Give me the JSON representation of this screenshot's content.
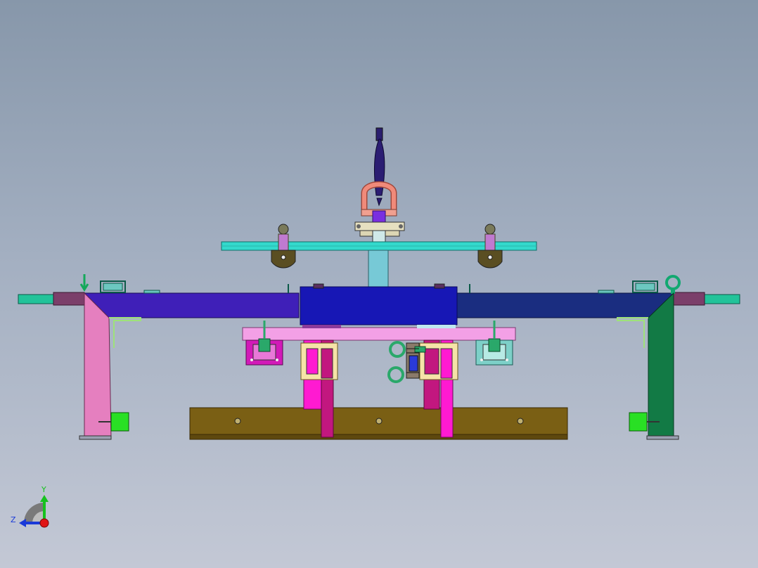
{
  "viewport": {
    "background_top": "#8797aa",
    "background_bottom": "#c3c8d5"
  },
  "model": {
    "colors": {
      "base_rail": "#7a5f14",
      "main_beam_left": "#3f1fb8",
      "main_beam_center": "#1717b5",
      "main_beam_right": "#1a2d80",
      "cross_bar": "#33d9cc",
      "mount_plate": "#f3a0e6",
      "leg_left": "#e57fbf",
      "leg_right": "#127a45",
      "column_magenta": "#ff1ad1",
      "column_dark": "#c2177f",
      "shackle": "#f08a7a",
      "hook": "#2a1e6e",
      "end_stub_left": "#22c39a",
      "end_stub_right": "#22c39a",
      "foot_block": "#29e024"
    }
  },
  "triad": {
    "x_label": "",
    "y_label": "Y",
    "z_label": "Z",
    "y_color": "#16c21e",
    "z_color": "#1a3ad8",
    "x_color": "#e01515"
  }
}
